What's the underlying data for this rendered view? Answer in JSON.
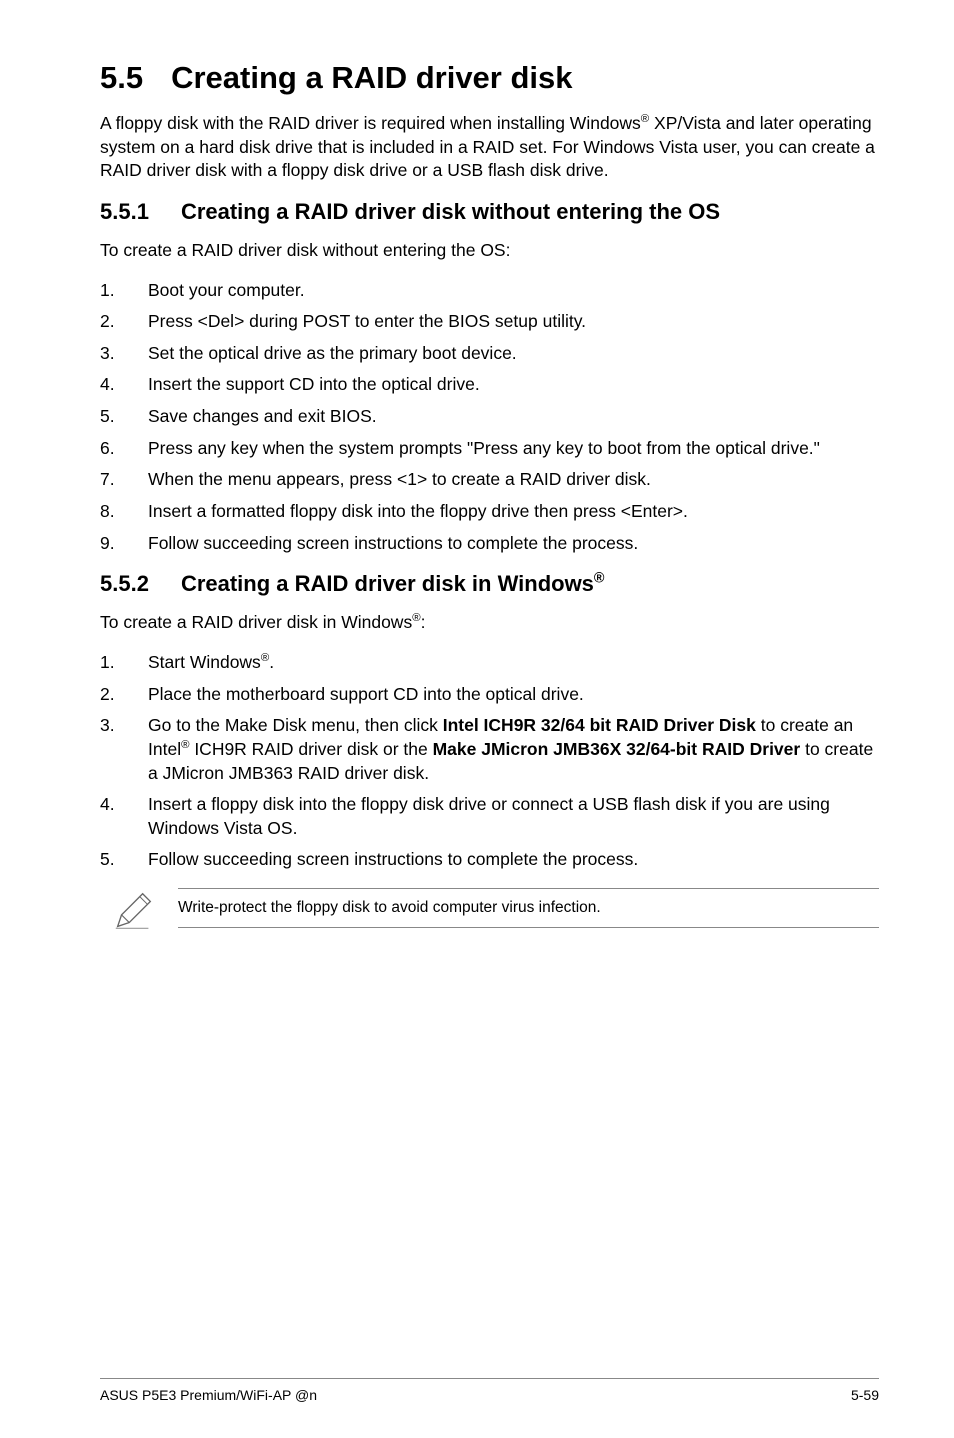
{
  "title": {
    "num": "5.5",
    "text": "Creating a RAID driver disk"
  },
  "intro": "A floppy disk with the RAID driver is required when installing Windows® XP/Vista and later operating system on a hard disk drive that is included in a RAID set. For Windows Vista user, you can create a RAID driver disk with a floppy disk drive or a USB flash disk drive.",
  "sec1": {
    "num": "5.5.1",
    "title": "Creating a RAID driver disk without entering the OS",
    "lead": "To create a RAID driver disk without entering the OS:",
    "items": [
      {
        "n": "1.",
        "t": "Boot your computer."
      },
      {
        "n": "2.",
        "t": "Press <Del> during POST to enter the BIOS setup utility."
      },
      {
        "n": "3.",
        "t": "Set the optical drive as the primary boot device."
      },
      {
        "n": "4.",
        "t": "Insert the support CD into the optical drive."
      },
      {
        "n": "5.",
        "t": "Save changes and exit BIOS."
      },
      {
        "n": "6.",
        "t": "Press any key when the system prompts \"Press any key to boot from the optical drive.\""
      },
      {
        "n": "7.",
        "t": "When the menu appears, press <1> to create a RAID driver disk."
      },
      {
        "n": "8.",
        "t": "Insert a formatted floppy disk into the floppy drive then press <Enter>."
      },
      {
        "n": "9.",
        "t": "Follow succeeding screen instructions to complete the process."
      }
    ]
  },
  "sec2": {
    "num": "5.5.2",
    "title_pre": "Creating a RAID driver disk in Windows",
    "lead_pre": "To create a RAID driver disk in Windows",
    "lead_post": ":",
    "items": [
      {
        "n": "1.",
        "pre": "Start Windows",
        "post": "."
      },
      {
        "n": "2.",
        "t": "Place the motherboard support CD into the optical drive."
      },
      {
        "n": "3.",
        "t1": "Go to the Make Disk menu, then click ",
        "b1": "Intel ICH9R 32/64 bit RAID Driver Disk",
        "t2": " to create an Intel",
        "t3": " ICH9R RAID driver disk or the ",
        "b2": "Make JMicron JMB36X 32/64-bit RAID Driver",
        "t4": " to create a JMicron JMB363 RAID driver disk."
      },
      {
        "n": "4.",
        "t": "Insert a floppy disk into the floppy disk drive or connect a USB flash disk if you are using Windows Vista OS."
      },
      {
        "n": "5.",
        "t": "Follow succeeding screen instructions to complete the process."
      }
    ]
  },
  "note": "Write-protect the floppy disk to avoid computer virus infection.",
  "footer": {
    "left": "ASUS P5E3 Premium/WiFi-AP @n",
    "right": "5-59"
  }
}
